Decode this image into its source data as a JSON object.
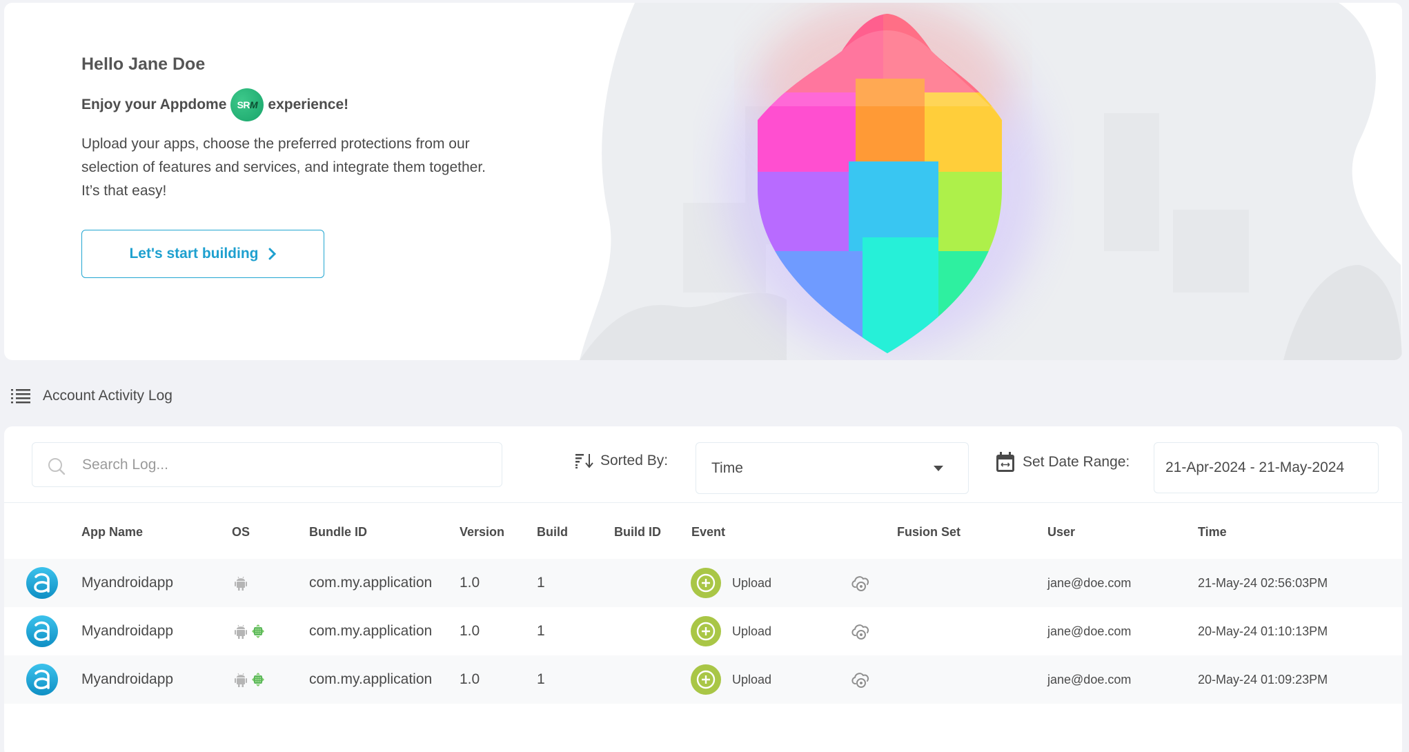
{
  "hero": {
    "greeting": "Hello Jane Doe",
    "tagline_before": "Enjoy your Appdome",
    "badge_text_sr": "SR",
    "badge_text_m": "M",
    "tagline_after": "experience!",
    "description": "Upload your apps, choose the preferred protections from our selection of features and services, and integrate them together. It’s that easy!",
    "cta_label": "Let's start building",
    "cta_icon": "chevron-right-icon"
  },
  "activity_log": {
    "title": "Account Activity Log",
    "title_icon": "list-icon",
    "search": {
      "placeholder": "Search Log...",
      "value": ""
    },
    "sort": {
      "label": "Sorted By:",
      "selected": "Time"
    },
    "date_range": {
      "label": "Set Date Range:",
      "value": "21-Apr-2024 - 21-May-2024"
    },
    "columns": [
      "App Name",
      "OS",
      "Bundle ID",
      "Version",
      "Build",
      "Build ID",
      "Event",
      "Fusion Set",
      "User",
      "Time"
    ],
    "rows": [
      {
        "app_name": "Myandroidapp",
        "os": [
          "android"
        ],
        "bundle_id": "com.my.application",
        "version": "1.0",
        "build": "1",
        "build_id": "",
        "event": "Upload",
        "fusion_set": "",
        "user": "jane@doe.com",
        "time": "21-May-24 02:56:03PM"
      },
      {
        "app_name": "Myandroidapp",
        "os": [
          "android",
          "android-green"
        ],
        "bundle_id": "com.my.application",
        "version": "1.0",
        "build": "1",
        "build_id": "",
        "event": "Upload",
        "fusion_set": "",
        "user": "jane@doe.com",
        "time": "20-May-24 01:10:13PM"
      },
      {
        "app_name": "Myandroidapp",
        "os": [
          "android",
          "android-green"
        ],
        "bundle_id": "com.my.application",
        "version": "1.0",
        "build": "1",
        "build_id": "",
        "event": "Upload",
        "fusion_set": "",
        "user": "jane@doe.com",
        "time": "20-May-24 01:09:23PM"
      }
    ]
  },
  "colors": {
    "accent": "#1ea0cf",
    "event_green": "#a9c646",
    "app_icon_blue": "#1fa6d6",
    "srm_green": "#1fae6f",
    "page_bg": "#f1f2f6"
  }
}
